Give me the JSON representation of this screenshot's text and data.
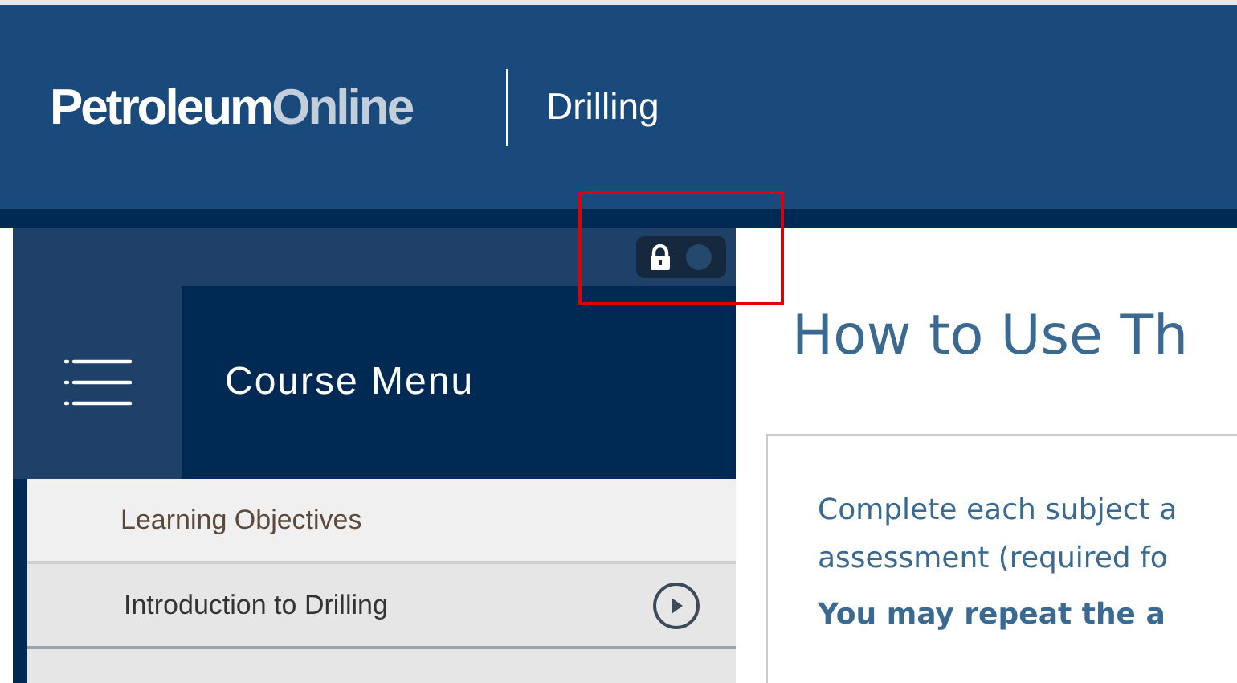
{
  "header": {
    "logo": {
      "part_1": "Petroleum",
      "part_2": "Online"
    },
    "course": "Drilling"
  },
  "lock_toggle": {
    "on": true
  },
  "course_menu": {
    "title": "Course Menu",
    "items": [
      {
        "label": "Learning Objectives",
        "selected": false,
        "play": false
      },
      {
        "label": "Introduction to Drilling",
        "selected": true,
        "play": true
      }
    ]
  },
  "content": {
    "title": "How to Use Th",
    "paragraph": [
      "Complete each subject a",
      "assessment (required fo"
    ],
    "bold_note": "You may repeat the a"
  }
}
